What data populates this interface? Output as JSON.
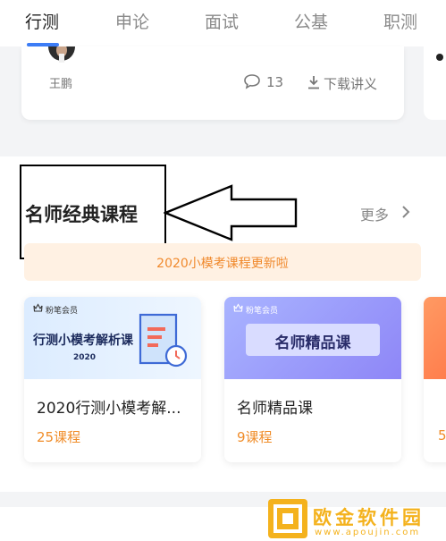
{
  "tabs": [
    {
      "label": "行测",
      "active": true
    },
    {
      "label": "申论",
      "active": false
    },
    {
      "label": "面试",
      "active": false
    },
    {
      "label": "公基",
      "active": false
    },
    {
      "label": "职测",
      "active": false
    }
  ],
  "previous_card": {
    "teacher": "王鹏",
    "comment_count": "13",
    "download_label": "下载讲义"
  },
  "section": {
    "title": "名师经典课程",
    "more_label": "更多",
    "banner_text": "2020小模考课程更新啦"
  },
  "courses": [
    {
      "brand": "粉笔会员",
      "thumb_title": "行测小模考解析课",
      "thumb_year": "2020",
      "name": "2020行测小模考解...",
      "count": "25课程"
    },
    {
      "brand": "粉笔会员",
      "thumb_title": "名师精品课",
      "name": "名师精品课",
      "count": "9课程"
    },
    {
      "count": "5"
    }
  ],
  "watermark": {
    "text": "欧金软件园",
    "url": "www.apoujin.com"
  },
  "colors": {
    "accent": "#3d7df6",
    "orange": "#f08d2a",
    "banner_bg": "#fff1e3"
  }
}
